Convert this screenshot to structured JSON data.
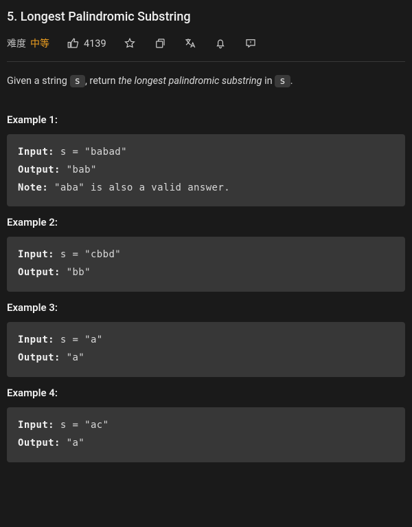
{
  "title": "5. Longest Palindromic Substring",
  "meta": {
    "difficulty_label": "难度",
    "difficulty_value": "中等",
    "likes": "4139"
  },
  "description": {
    "p1": "Given a string ",
    "code1": "s",
    "p2": ", return ",
    "italic": "the longest palindromic substring",
    "p3": " in ",
    "code2": "s",
    "p4": "."
  },
  "examples": [
    {
      "title": "Example 1:",
      "lines": [
        {
          "label": "Input:",
          "rest": " s = \"babad\""
        },
        {
          "label": "Output:",
          "rest": " \"bab\""
        },
        {
          "label": "Note:",
          "rest": " \"aba\" is also a valid answer."
        }
      ]
    },
    {
      "title": "Example 2:",
      "lines": [
        {
          "label": "Input:",
          "rest": " s = \"cbbd\""
        },
        {
          "label": "Output:",
          "rest": " \"bb\""
        }
      ]
    },
    {
      "title": "Example 3:",
      "lines": [
        {
          "label": "Input:",
          "rest": " s = \"a\""
        },
        {
          "label": "Output:",
          "rest": " \"a\""
        }
      ]
    },
    {
      "title": "Example 4:",
      "lines": [
        {
          "label": "Input:",
          "rest": " s = \"ac\""
        },
        {
          "label": "Output:",
          "rest": " \"a\""
        }
      ]
    }
  ]
}
